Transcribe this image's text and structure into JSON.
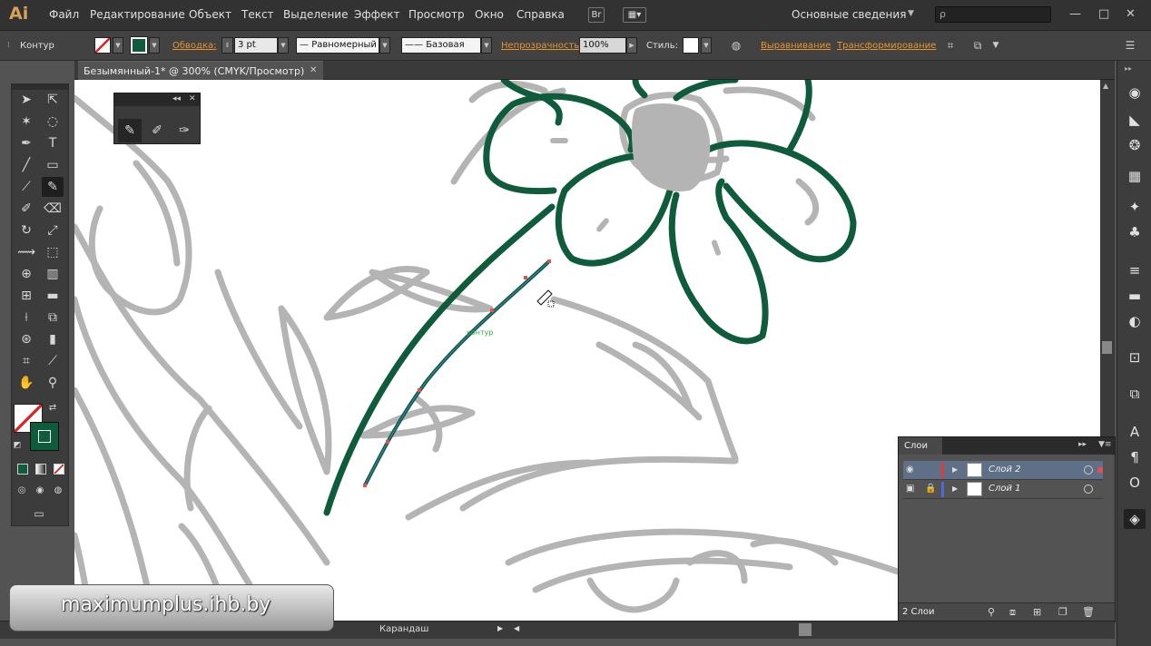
{
  "app": {
    "logo": "Ai"
  },
  "menu": [
    "Файл",
    "Редактирование",
    "Объект",
    "Текст",
    "Выделение",
    "Эффект",
    "Просмотр",
    "Окно",
    "Справка"
  ],
  "menubar_buttons": {
    "bridge": "Br"
  },
  "workspace": {
    "label": "Основные сведения"
  },
  "search": {
    "placeholder": "ρ"
  },
  "control": {
    "path_label": "Контур",
    "stroke_label": "Обводка:",
    "stroke_value": "3 pt",
    "profile_label": "Равномерный",
    "brush_label": "Базовая",
    "opacity_label": "Непрозрачность:",
    "opacity_value": "100%",
    "styles_label": "Стиль:",
    "align_link": "Выравнивание",
    "transform_link": "Трансформирование"
  },
  "document": {
    "tab_title": "Безымянный-1* @ 300% (CMYK/Просмотр)"
  },
  "canvas": {
    "hint": "контур"
  },
  "status": {
    "tool": "Карандаш"
  },
  "layers_panel": {
    "title": "Слои",
    "layers": [
      {
        "name": "Слой 2",
        "color": "#e03b3b",
        "selected": true,
        "locked": false
      },
      {
        "name": "Слой 1",
        "color": "#4a6bd6",
        "selected": false,
        "locked": true
      }
    ],
    "count": "2 Слои"
  },
  "watermark": "maximumplus.ihb.by",
  "colors": {
    "stroke_green": "#0e5c3c",
    "sketch_gray": "#b4b4b4",
    "anchor_red": "#e25050",
    "accent_orange": "#e8952a"
  }
}
